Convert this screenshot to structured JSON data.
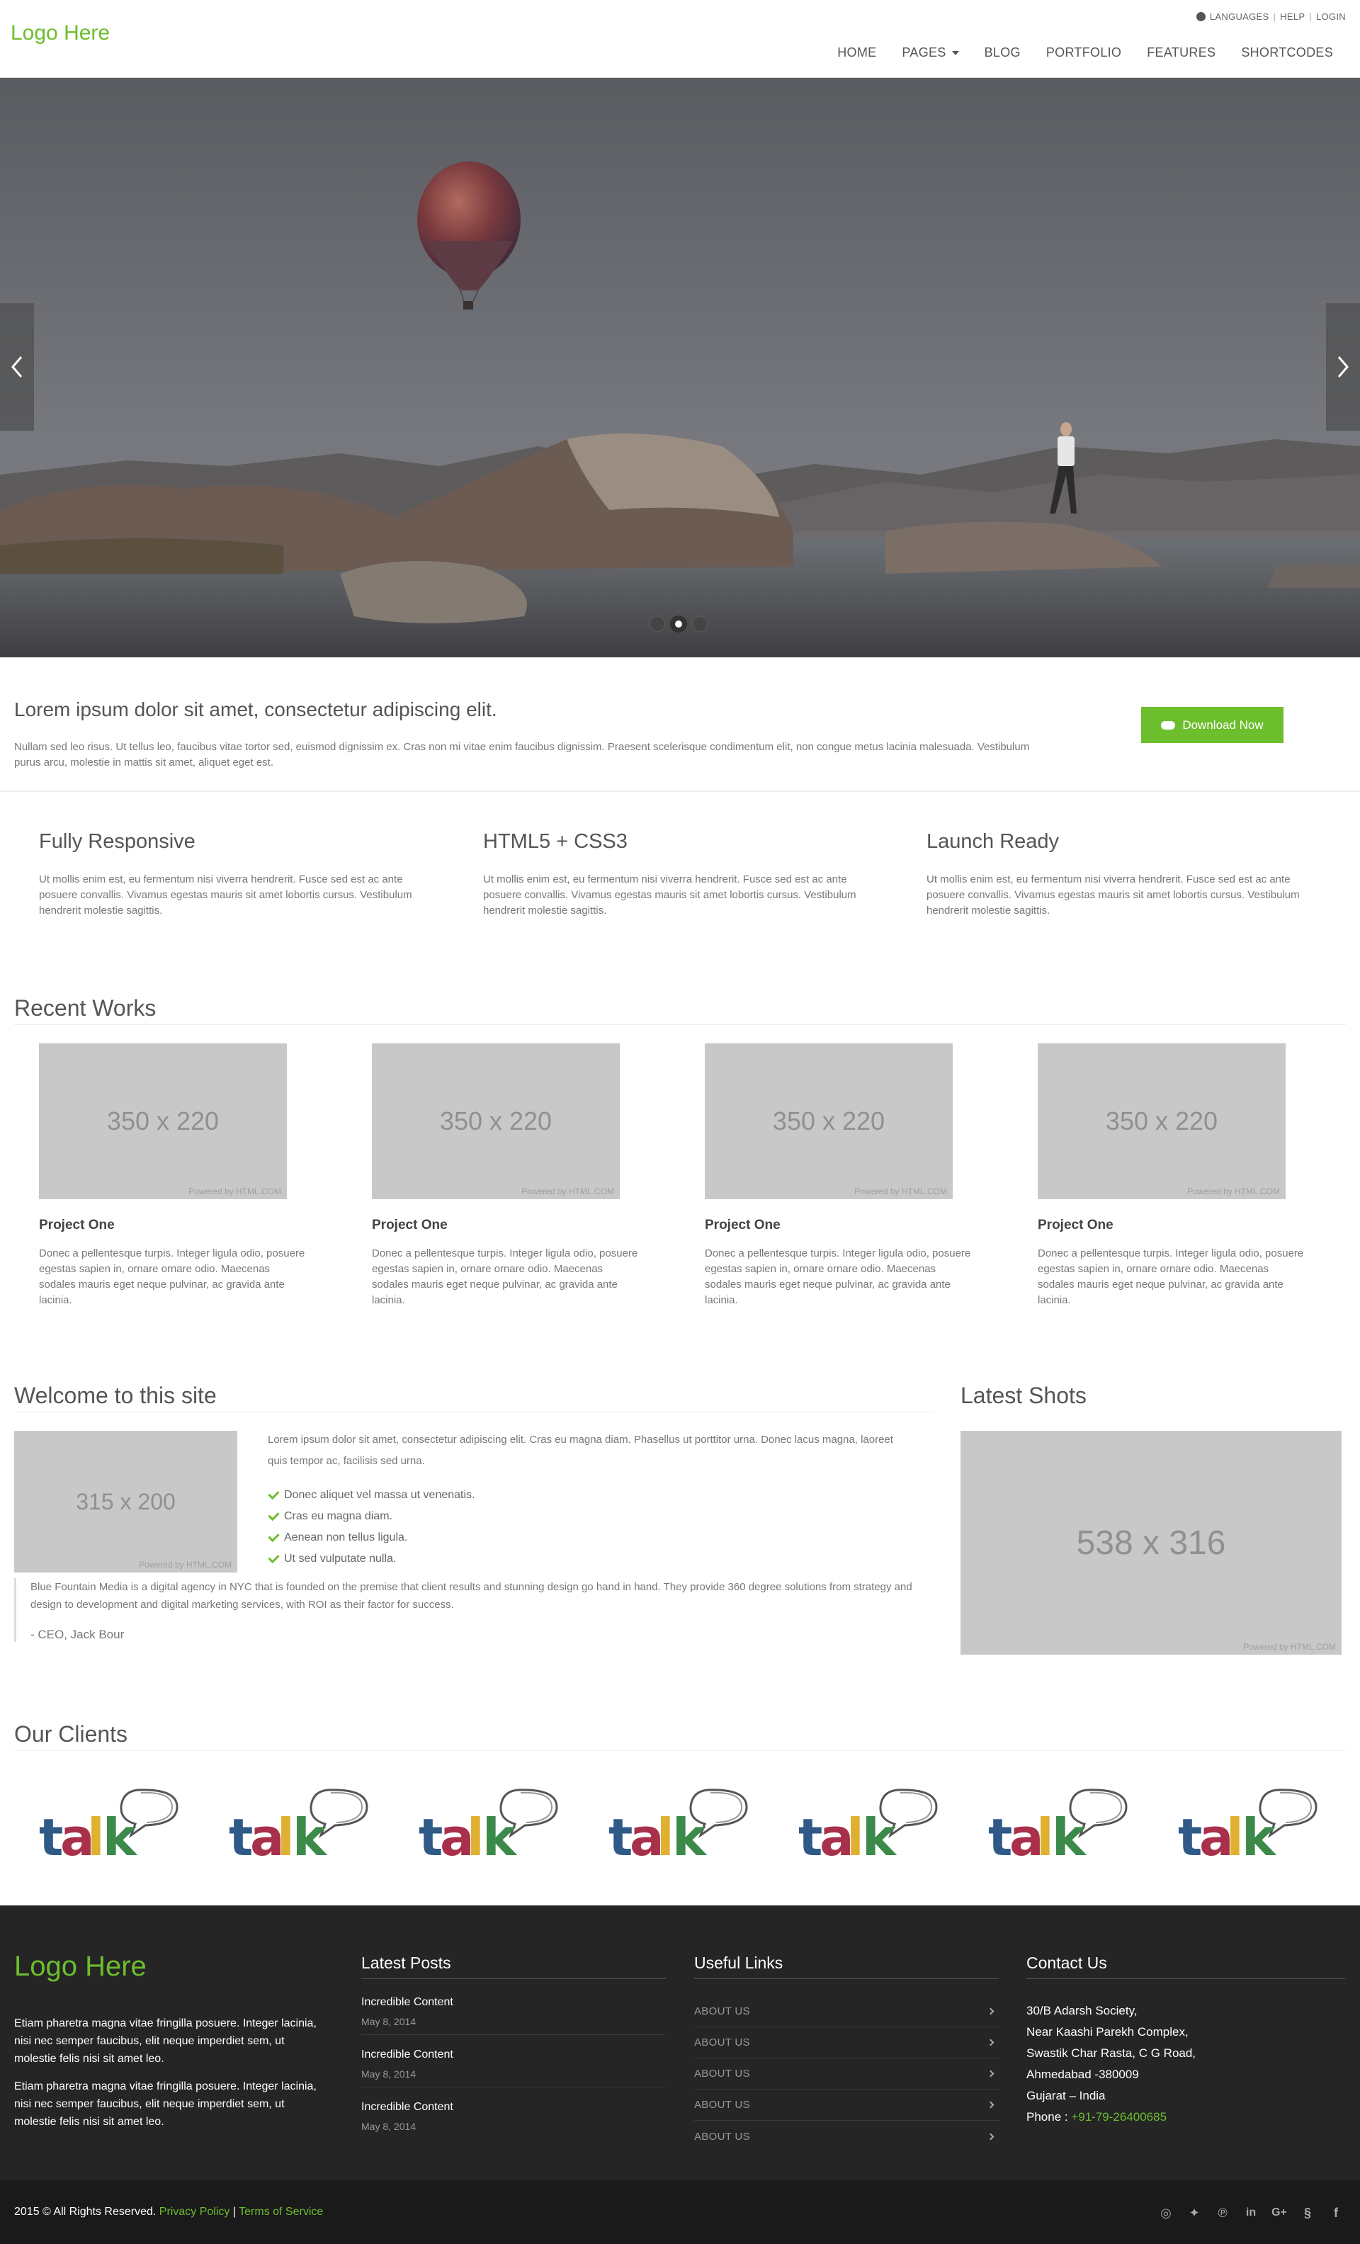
{
  "header": {
    "logo": "Logo Here",
    "topbar": {
      "languages": "LANGUAGES",
      "help": "HELP",
      "login": "LOGIN",
      "sep": "|"
    },
    "nav": [
      "HOME",
      "PAGES",
      "BLOG",
      "PORTFOLIO",
      "FEATURES",
      "SHORTCODES"
    ]
  },
  "slider": {
    "slide_count": 3,
    "active_slide": 2
  },
  "intro": {
    "heading": "Lorem ipsum dolor sit amet, consectetur adipiscing elit.",
    "text": "Nullam sed leo risus. Ut tellus leo, faucibus vitae tortor sed, euismod dignissim ex. Cras non mi vitae enim faucibus dignissim. Praesent scelerisque condimentum elit, non congue metus lacinia malesuada. Vestibulum purus arcu, molestie in mattis sit amet, aliquet eget est.",
    "button": "Download Now"
  },
  "features": [
    {
      "title": "Fully Responsive",
      "text": "Ut mollis enim est, eu fermentum nisi viverra hendrerit. Fusce sed est ac ante posuere convallis. Vivamus egestas mauris sit amet lobortis cursus. Vestibulum hendrerit molestie sagittis."
    },
    {
      "title": "HTML5 + CSS3",
      "text": "Ut mollis enim est, eu fermentum nisi viverra hendrerit. Fusce sed est ac ante posuere convallis. Vivamus egestas mauris sit amet lobortis cursus. Vestibulum hendrerit molestie sagittis."
    },
    {
      "title": "Launch Ready",
      "text": "Ut mollis enim est, eu fermentum nisi viverra hendrerit. Fusce sed est ac ante posuere convallis. Vivamus egestas mauris sit amet lobortis cursus. Vestibulum hendrerit molestie sagittis."
    }
  ],
  "recent_works": {
    "title": "Recent Works",
    "items": [
      {
        "image_label": "350 x 220",
        "powered": "Powered by HTML.COM",
        "title": "Project One",
        "text": "Donec a pellentesque turpis. Integer ligula odio, posuere egestas sapien in, ornare ornare odio. Maecenas sodales mauris eget neque pulvinar, ac gravida ante lacinia."
      },
      {
        "image_label": "350 x 220",
        "powered": "Powered by HTML.COM",
        "title": "Project One",
        "text": "Donec a pellentesque turpis. Integer ligula odio, posuere egestas sapien in, ornare ornare odio. Maecenas sodales mauris eget neque pulvinar, ac gravida ante lacinia."
      },
      {
        "image_label": "350 x 220",
        "powered": "Powered by HTML.COM",
        "title": "Project One",
        "text": "Donec a pellentesque turpis. Integer ligula odio, posuere egestas sapien in, ornare ornare odio. Maecenas sodales mauris eget neque pulvinar, ac gravida ante lacinia."
      },
      {
        "image_label": "350 x 220",
        "powered": "Powered by HTML.COM",
        "title": "Project One",
        "text": "Donec a pellentesque turpis. Integer ligula odio, posuere egestas sapien in, ornare ornare odio. Maecenas sodales mauris eget neque pulvinar, ac gravida ante lacinia."
      }
    ]
  },
  "welcome": {
    "title": "Welcome to this site",
    "image_label": "315 x 200",
    "powered": "Powered by HTML.COM",
    "text": "Lorem ipsum dolor sit amet, consectetur adipiscing elit. Cras eu magna diam. Phasellus ut porttitor urna. Donec lacus magna, laoreet quis tempor ac, facilisis sed urna.",
    "list": [
      "Donec aliquet vel massa ut venenatis.",
      "Cras eu magna diam.",
      "Aenean non tellus ligula.",
      "Ut sed vulputate nulla."
    ],
    "quote": "Blue Fountain Media is a digital agency in NYC that is founded on the premise that client results and stunning design go hand in hand. They provide 360 degree solutions from strategy and design to development and digital marketing services, with ROI as their factor for success.",
    "author": "- CEO, Jack Bour"
  },
  "latest_shots": {
    "title": "Latest Shots",
    "image_label": "538 x 316",
    "powered": "Powered by HTML.COM"
  },
  "clients": {
    "title": "Our Clients",
    "logo_word": "talk",
    "count": 7
  },
  "footer": {
    "logo": "Logo Here",
    "about": [
      "Etiam pharetra magna vitae fringilla posuere. Integer lacinia, nisi nec semper faucibus, elit neque imperdiet sem, ut molestie felis nisi sit amet leo.",
      "Etiam pharetra magna vitae fringilla posuere. Integer lacinia, nisi nec semper faucibus, elit neque imperdiet sem, ut molestie felis nisi sit amet leo."
    ],
    "posts_title": "Latest Posts",
    "posts": [
      {
        "title": "Incredible Content",
        "date": "May 8, 2014"
      },
      {
        "title": "Incredible Content",
        "date": "May 8, 2014"
      },
      {
        "title": "Incredible Content",
        "date": "May 8, 2014"
      }
    ],
    "links_title": "Useful Links",
    "links": [
      "ABOUT US",
      "ABOUT US",
      "ABOUT US",
      "ABOUT US",
      "ABOUT US"
    ],
    "contact_title": "Contact Us",
    "contact": [
      "30/B Adarsh Society,",
      "Near Kaashi Parekh Complex,",
      "Swastik Char Rasta, C G Road,",
      "Ahmedabad -380009",
      "Gujarat – India"
    ],
    "phone_label": "Phone :",
    "phone": "+91-79-26400685"
  },
  "bottom": {
    "copyright": "2015 © All Rights Reserved.",
    "privacy": "Privacy Policy",
    "divider": "|",
    "terms": "Terms of Service",
    "social": [
      "dribbble-icon",
      "twitter-icon",
      "pinterest-icon",
      "linkedin-icon",
      "google-plus-icon",
      "skype-icon",
      "facebook-icon"
    ]
  },
  "colors": {
    "accent": "#6dbe2d",
    "footer_bg": "#252525",
    "bottom_bg": "#1a1a1a",
    "placeholder": "#c8c8c8"
  }
}
